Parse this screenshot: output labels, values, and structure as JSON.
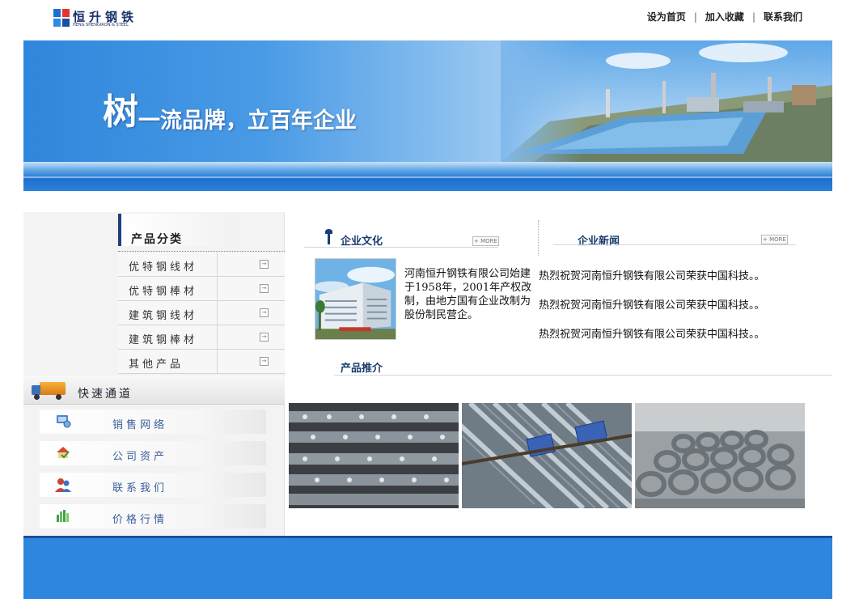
{
  "header": {
    "logo_cn": "恒升钢铁",
    "logo_en": "HENG SHENGIRON & STEEL",
    "links": [
      "设为首页",
      "加入收藏",
      "联系我们"
    ],
    "link_sep": "|"
  },
  "banner": {
    "slogan_big": "树",
    "slogan_rest": "一流品牌，立百年企业"
  },
  "sidebar": {
    "category_title": "产品分类",
    "categories": [
      {
        "label": "优特钢线材",
        "arrow": "→"
      },
      {
        "label": "优特钢棒材",
        "arrow": "→"
      },
      {
        "label": "建筑钢线材",
        "arrow": "→"
      },
      {
        "label": "建筑钢棒材",
        "arrow": "→"
      },
      {
        "label": "其他产品",
        "arrow": "→"
      }
    ],
    "quick_title": "快速通道",
    "quick_links": [
      {
        "label": "销售网络",
        "icon": "network-icon"
      },
      {
        "label": "公司资产",
        "icon": "house-check-icon"
      },
      {
        "label": "联系我们",
        "icon": "people-icon"
      },
      {
        "label": "价格行情",
        "icon": "bar-chart-icon"
      }
    ]
  },
  "culture": {
    "title": "企业文化",
    "more": "+ MORE",
    "text": "河南恒升钢铁有限公司始建于1958年，2001年产权改制，由地方国有企业改制为股份制民营企。"
  },
  "news": {
    "title": "企业新闻",
    "more": "+ MORE",
    "items": [
      "热烈祝贺河南恒升钢铁有限公司荣获中国科技。。",
      "热烈祝贺河南恒升钢铁有限公司荣获中国科技。。",
      "热烈祝贺河南恒升钢铁有限公司荣获中国科技。。"
    ]
  },
  "products": {
    "title": "产品推介"
  },
  "colors": {
    "brand_blue": "#2e86df",
    "dark_navy": "#1c3b6e",
    "logo_red": "#e7332b"
  }
}
